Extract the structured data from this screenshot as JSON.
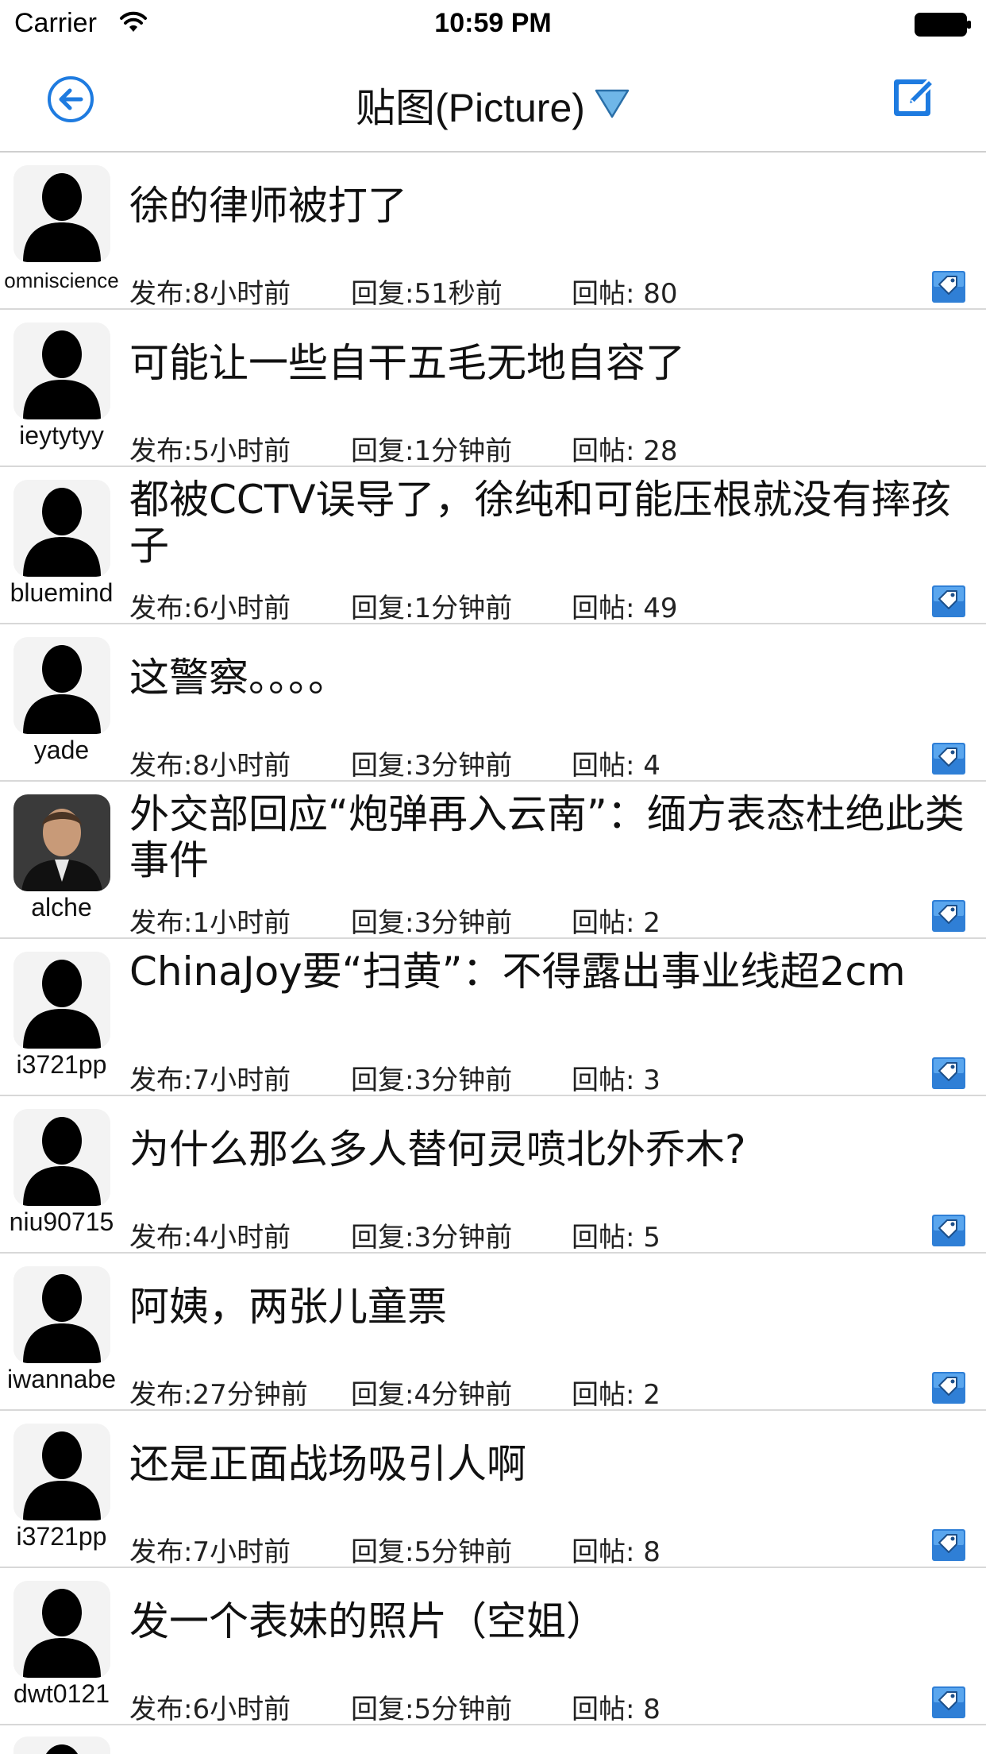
{
  "status_bar": {
    "carrier": "Carrier",
    "time": "10:59 PM"
  },
  "nav": {
    "title": "贴图(Picture)",
    "back_icon": "back-arrow-circle-icon",
    "compose_icon": "compose-edit-icon",
    "dropdown_icon": "triangle-down-icon"
  },
  "colors": {
    "accent": "#1e7be0",
    "divider": "#d8d8d8"
  },
  "posts": [
    {
      "user": "omniscience",
      "title": "徐的律师被打了",
      "posted": "发布:8小时前",
      "replied": "回复:51秒前",
      "replies": "回帖: 80",
      "tag": true,
      "photo": false
    },
    {
      "user": "ieytytyy",
      "title": "可能让一些自干五毛无地自容了",
      "posted": "发布:5小时前",
      "replied": "回复:1分钟前",
      "replies": "回帖: 28",
      "tag": false,
      "photo": false
    },
    {
      "user": "bluemind",
      "title": "都被CCTV误导了，徐纯和可能压根就没有摔孩子",
      "posted": "发布:6小时前",
      "replied": "回复:1分钟前",
      "replies": "回帖: 49",
      "tag": true,
      "photo": false
    },
    {
      "user": "yade",
      "title": "这警察。。。。",
      "posted": "发布:8小时前",
      "replied": "回复:3分钟前",
      "replies": "回帖: 4",
      "tag": true,
      "photo": false
    },
    {
      "user": "alche",
      "title": "外交部回应“炮弹再入云南”：缅方表态杜绝此类事件",
      "posted": "发布:1小时前",
      "replied": "回复:3分钟前",
      "replies": "回帖: 2",
      "tag": true,
      "photo": true
    },
    {
      "user": "i3721pp",
      "title": "ChinaJoy要“扫黄”：不得露出事业线超2cm",
      "posted": "发布:7小时前",
      "replied": "回复:3分钟前",
      "replies": "回帖: 3",
      "tag": true,
      "photo": false
    },
    {
      "user": "niu90715",
      "title": "为什么那么多人替何灵喷北外乔木?",
      "posted": "发布:4小时前",
      "replied": "回复:3分钟前",
      "replies": "回帖: 5",
      "tag": true,
      "photo": false
    },
    {
      "user": "iwannabe",
      "title": "阿姨，两张儿童票",
      "posted": "发布:27分钟前",
      "replied": "回复:4分钟前",
      "replies": "回帖: 2",
      "tag": true,
      "photo": false
    },
    {
      "user": "i3721pp",
      "title": "还是正面战场吸引人啊",
      "posted": "发布:7小时前",
      "replied": "回复:5分钟前",
      "replies": "回帖: 8",
      "tag": true,
      "photo": false
    },
    {
      "user": "dwt0121",
      "title": "发一个表妹的照片（空姐）",
      "posted": "发布:6小时前",
      "replied": "回复:5分钟前",
      "replies": "回帖: 8",
      "tag": true,
      "photo": false
    }
  ]
}
